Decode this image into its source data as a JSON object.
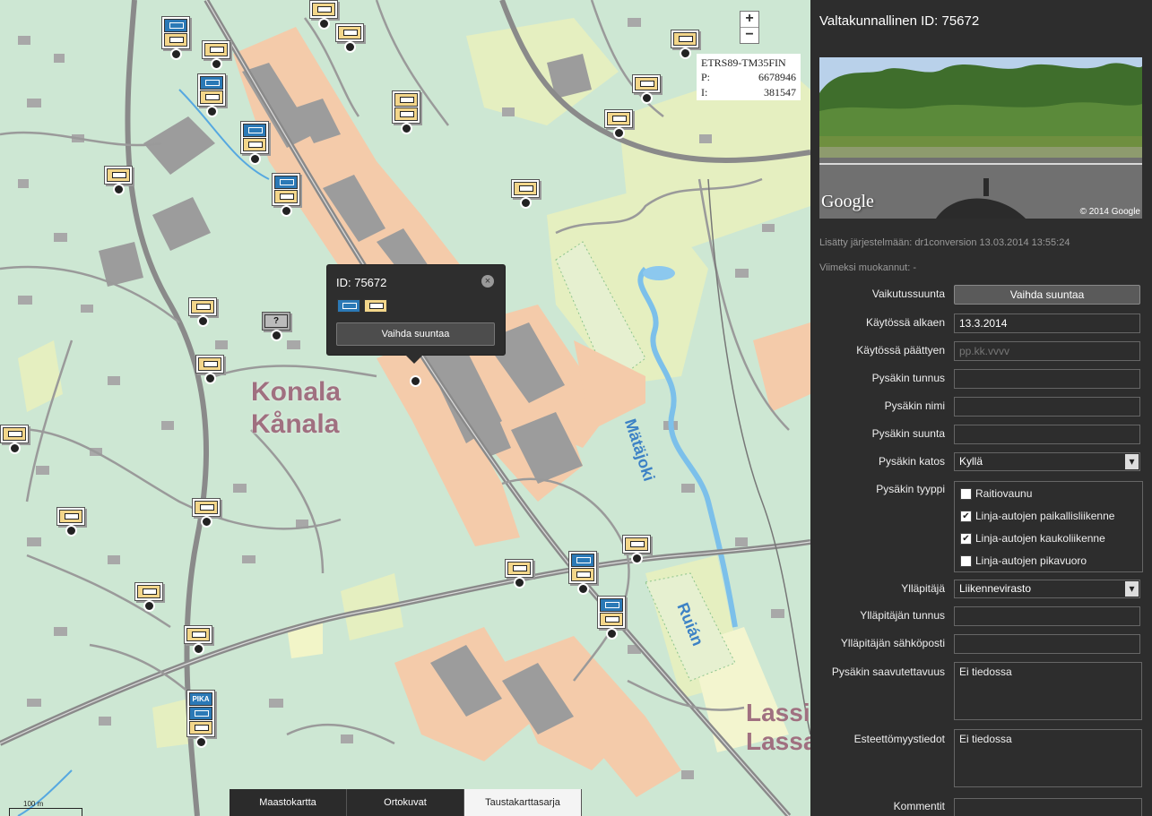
{
  "map": {
    "zoom_in": "+",
    "zoom_out": "−",
    "coords": {
      "system": "ETRS89-TM35FIN",
      "p_label": "P:",
      "p_value": "6678946",
      "i_label": "I:",
      "i_value": "381547"
    },
    "place_primary": "Konala",
    "place_secondary": "Kånala",
    "place_right_1": "Lassi",
    "place_right_2": "Lassa",
    "river_1": "Mätäjoki",
    "river_2": "Ruián",
    "popup": {
      "title": "ID: 75672",
      "close": "×",
      "button": "Vaihda suuntaa"
    },
    "unknown_stop": "?",
    "pika_label": "PIKA",
    "scale": {
      "label_1": "100 m",
      "label_2": ""
    },
    "tabs": [
      "Maastokartta",
      "Ortokuvat",
      "Taustakarttasarja"
    ],
    "active_tab": "Taustakarttasarja"
  },
  "panel": {
    "title": "Valtakunnallinen ID: 75672",
    "photo": {
      "logo": "Google",
      "copyright": "© 2014 Google"
    },
    "added": "Lisätty järjestelmään: dr1conversion 13.03.2014 13:55:24",
    "modified": "Viimeksi muokannut: -",
    "fields": {
      "direction": {
        "label": "Vaikutussuunta",
        "button": "Vaihda suuntaa"
      },
      "start": {
        "label": "Käytössä alkaen",
        "value": "13.3.2014"
      },
      "end": {
        "label": "Käytössä päättyen",
        "placeholder": "pp.kk.vvvv"
      },
      "code": {
        "label": "Pysäkin tunnus",
        "value": ""
      },
      "name": {
        "label": "Pysäkin nimi",
        "value": ""
      },
      "heading": {
        "label": "Pysäkin suunta",
        "value": ""
      },
      "shelter": {
        "label": "Pysäkin katos",
        "value": "Kyllä"
      },
      "type": {
        "label": "Pysäkin tyyppi",
        "options": [
          {
            "label": "Raitiovaunu",
            "checked": false
          },
          {
            "label": "Linja-autojen paikallisliikenne",
            "checked": true
          },
          {
            "label": "Linja-autojen kaukoliikenne",
            "checked": true
          },
          {
            "label": "Linja-autojen pikavuoro",
            "checked": false
          }
        ]
      },
      "maintainer": {
        "label": "Ylläpitäjä",
        "value": "Liikennevirasto"
      },
      "maintainer_code": {
        "label": "Ylläpitäjän tunnus",
        "value": ""
      },
      "maintainer_email": {
        "label": "Ylläpitäjän sähköposti",
        "value": ""
      },
      "accessibility": {
        "label": "Pysäkin saavutettavuus",
        "value": "Ei tiedossa"
      },
      "barrier_free": {
        "label": "Esteettömyystiedot",
        "value": "Ei tiedossa"
      },
      "comments": {
        "label": "Kommentit",
        "value": ""
      }
    }
  },
  "colors": {
    "map_bg": "#cce6d2",
    "building": "#9a9a9a",
    "industrial": "#f6c8a8",
    "park": "#e6efc0",
    "water": "#8cc8ee",
    "panel_bg": "#2d2d2d"
  }
}
